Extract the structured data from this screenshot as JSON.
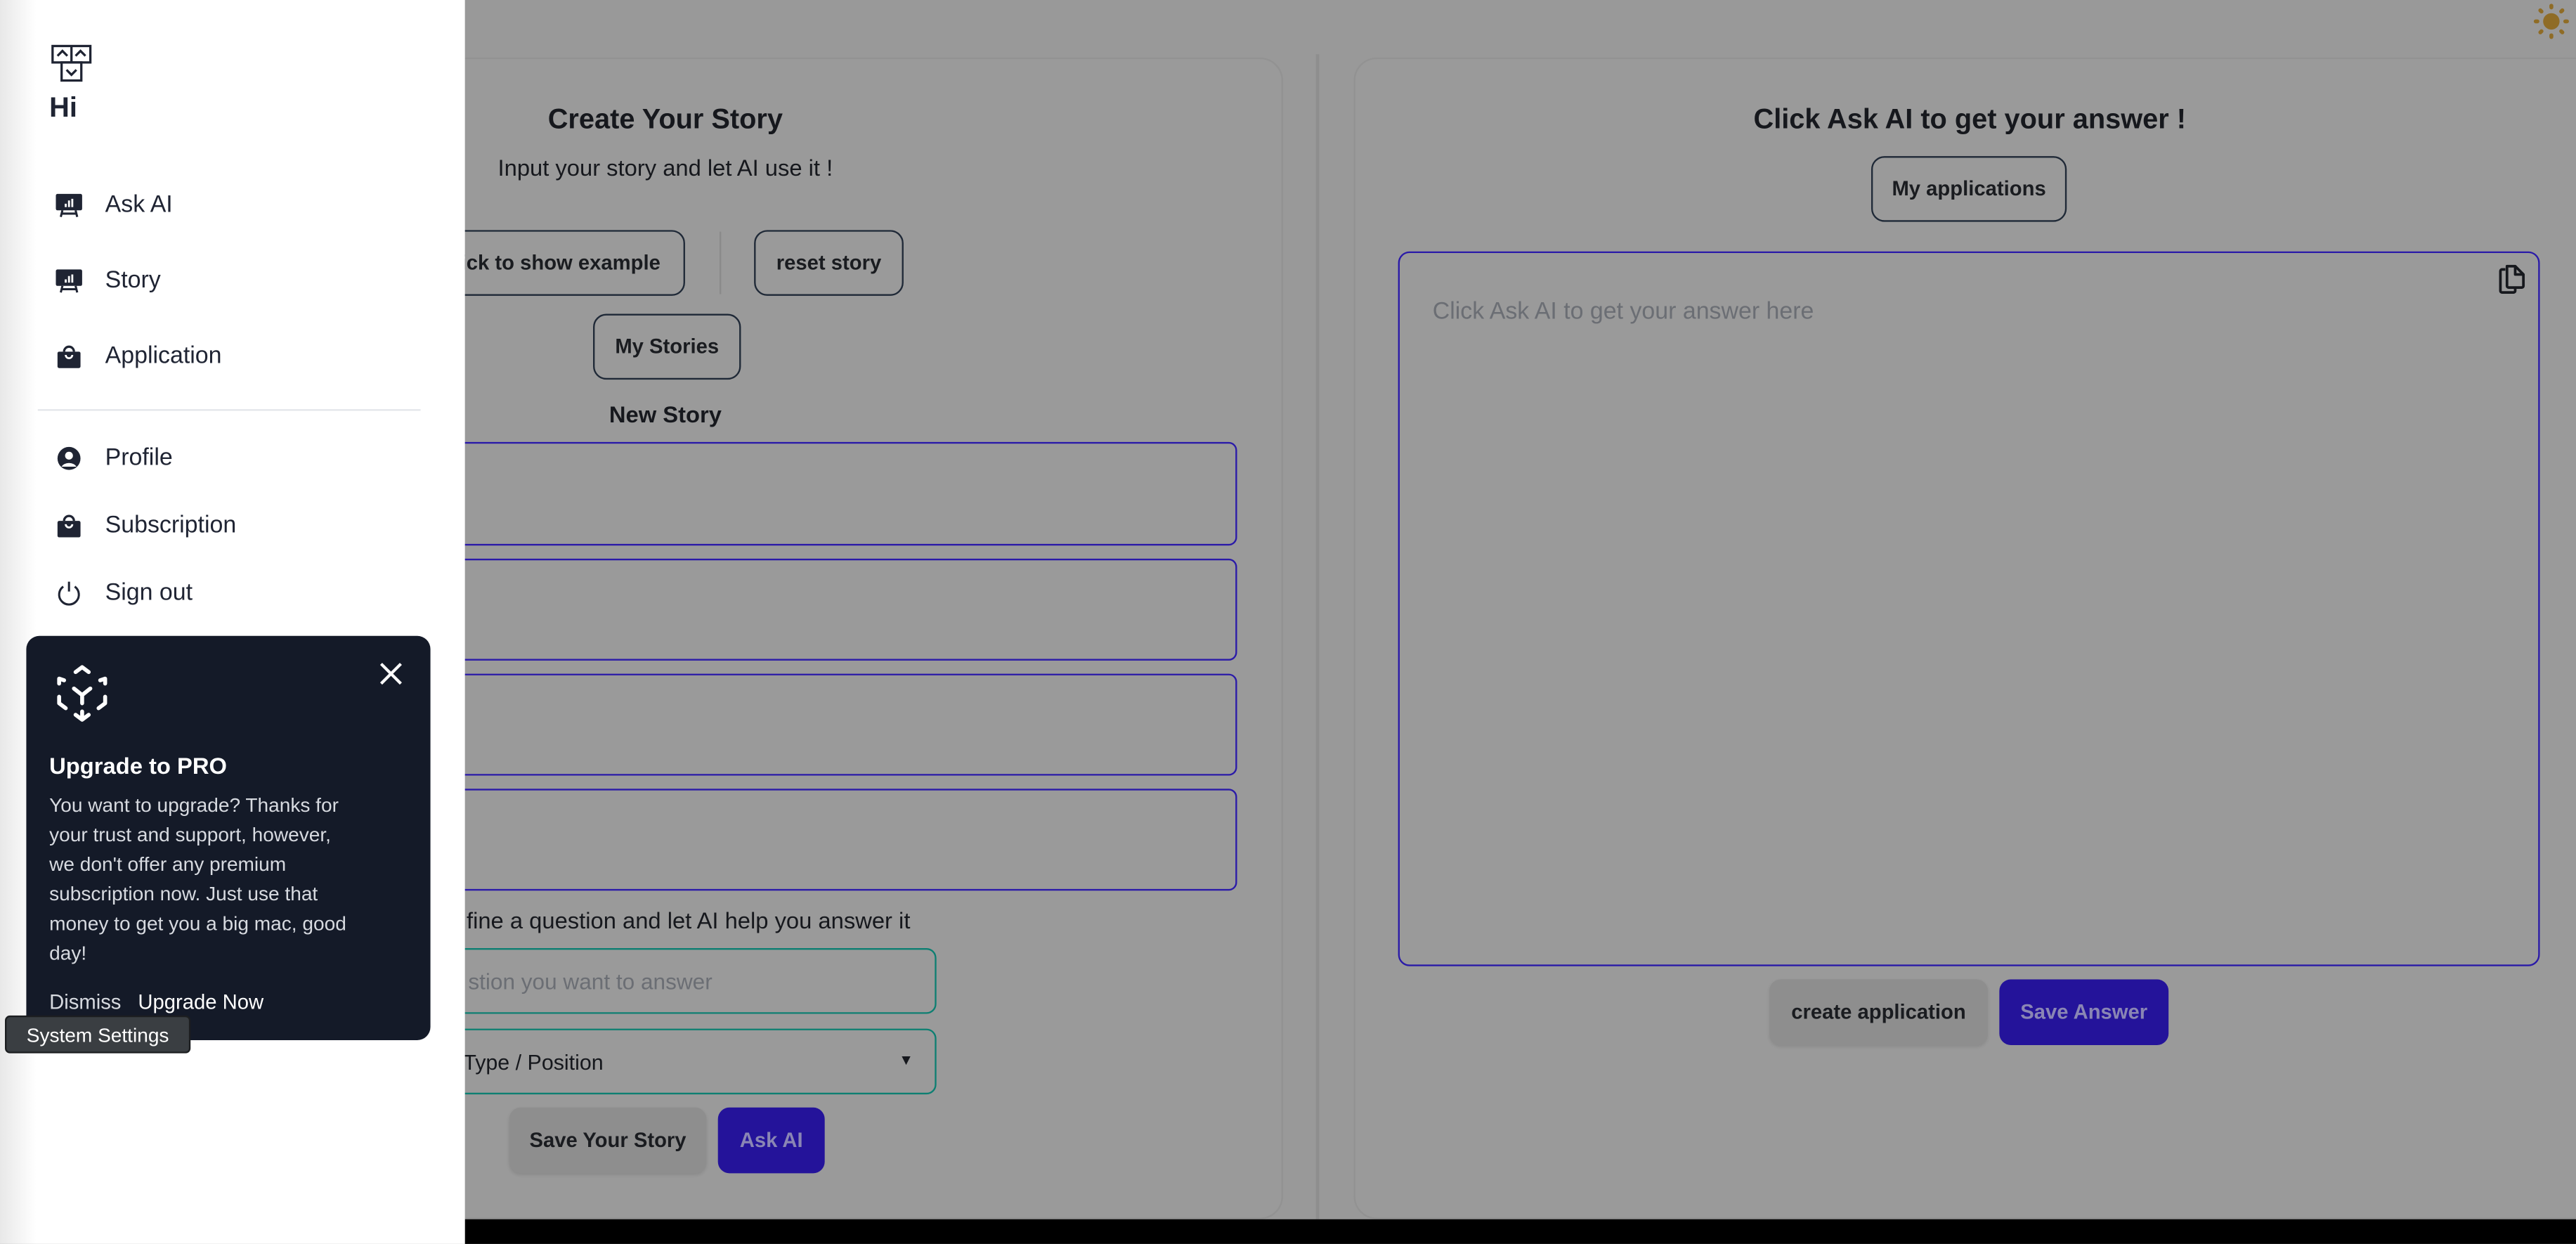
{
  "theme_toggle": {
    "icon": "sun-icon",
    "color": "#8f6c26"
  },
  "story_panel": {
    "title": "Create Your Story",
    "subtitle": "Input your story and let AI use it !",
    "show_example_label": "lick to show example",
    "reset_label": "reset story",
    "my_stories_label": "My Stories",
    "new_story_heading": "New Story",
    "story_fields": [
      "",
      "",
      "",
      ""
    ],
    "question_label": "fine a question and let AI help you answer it",
    "question_placeholder": "stion you want to answer",
    "type_select_value": "Type / Position",
    "save_label": "Save Your Story",
    "ask_label": "Ask AI"
  },
  "answer_panel": {
    "title": "Click Ask AI to get your answer !",
    "my_applications_label": "My applications",
    "answer_placeholder": "Click Ask AI to get your answer here",
    "create_application_label": "create application",
    "save_answer_label": "Save Answer"
  },
  "sidebar": {
    "greeting": "Hi",
    "items": [
      {
        "label": "Ask AI",
        "icon": "presentation-chart-icon"
      },
      {
        "label": "Story",
        "icon": "presentation-chart-icon"
      },
      {
        "label": "Application",
        "icon": "shopping-bag-icon"
      },
      {
        "label": "Profile",
        "icon": "user-circle-icon"
      },
      {
        "label": "Subscription",
        "icon": "shopping-bag-icon"
      },
      {
        "label": "Sign out",
        "icon": "power-icon"
      }
    ]
  },
  "promo": {
    "title": "Upgrade to PRO",
    "body": "You want to upgrade? Thanks for your trust and support, however, we don't offer any premium subscription now. Just use that money to get you a big mac, good day!",
    "dismiss_label": "Dismiss",
    "upgrade_label": "Upgrade Now"
  },
  "tooltip": {
    "label": "System Settings"
  },
  "colors": {
    "accent": "#24139a",
    "input_border": "#2a1aa8",
    "select_border": "#0d7f72",
    "promo_bg": "#141a28"
  }
}
